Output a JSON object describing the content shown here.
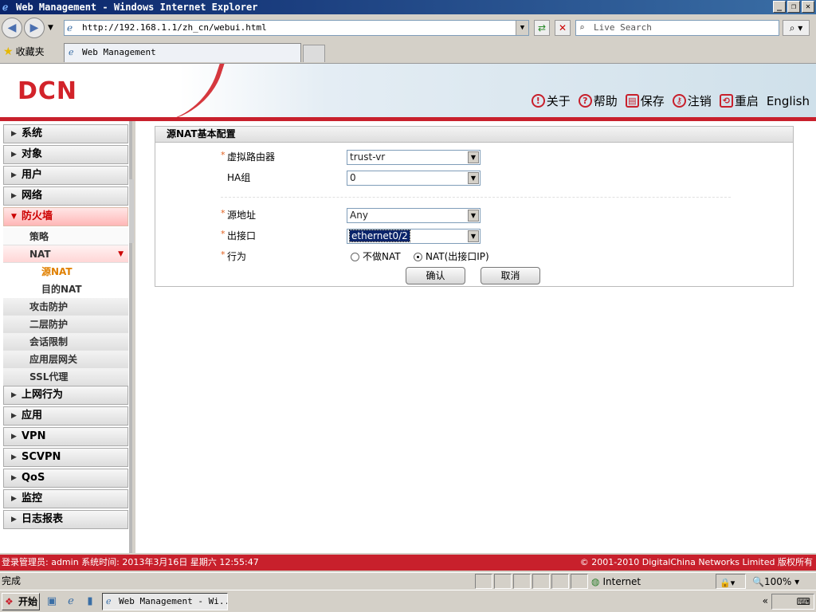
{
  "window": {
    "title": "Web Management - Windows Internet Explorer",
    "minimize": "_",
    "restore": "❐",
    "close": "✕"
  },
  "browser": {
    "address": "http://192.168.1.1/zh_cn/webui.html",
    "search_placeholder": "Live Search",
    "favorites_label": "收藏夹",
    "tab_title": "Web Management"
  },
  "header": {
    "logo": "DCN",
    "links": [
      {
        "icon": "info-icon",
        "glyph": "!",
        "label": "关于"
      },
      {
        "icon": "help-icon",
        "glyph": "?",
        "label": "帮助"
      },
      {
        "icon": "save-icon",
        "glyph": "▤",
        "label": "保存"
      },
      {
        "icon": "key-icon",
        "glyph": "⚷",
        "label": "注销"
      },
      {
        "icon": "restart-icon",
        "glyph": "⟲",
        "label": "重启"
      },
      {
        "icon": "",
        "glyph": "",
        "label": "English"
      }
    ]
  },
  "sidebar": {
    "items": [
      {
        "label": "系统"
      },
      {
        "label": "对象"
      },
      {
        "label": "用户"
      },
      {
        "label": "网络"
      },
      {
        "label": "防火墙"
      }
    ],
    "firewall_sub": [
      {
        "label": "策略"
      },
      {
        "label": "NAT"
      }
    ],
    "nat_sub": [
      {
        "label": "源NAT"
      },
      {
        "label": "目的NAT"
      }
    ],
    "firewall_sub2": [
      {
        "label": "攻击防护"
      },
      {
        "label": "二层防护"
      },
      {
        "label": "会话限制"
      },
      {
        "label": "应用层网关"
      },
      {
        "label": "SSL代理"
      }
    ],
    "items_after": [
      {
        "label": "上网行为"
      },
      {
        "label": "应用"
      },
      {
        "label": "VPN"
      },
      {
        "label": "SCVPN"
      },
      {
        "label": "QoS"
      },
      {
        "label": "监控"
      },
      {
        "label": "日志报表"
      }
    ]
  },
  "form": {
    "title": "源NAT基本配置",
    "required_mark": "*",
    "vrouter_label": "虚拟路由器",
    "vrouter_value": "trust-vr",
    "ha_label": "HA组",
    "ha_value": "0",
    "src_label": "源地址",
    "src_value": "Any",
    "egress_label": "出接口",
    "egress_value": "ethernet0/2",
    "action_label": "行为",
    "action_opt1": "不做NAT",
    "action_opt2": "NAT(出接口IP)",
    "action_selected": "NAT(出接口IP)",
    "confirm": "确认",
    "cancel": "取消"
  },
  "footer": {
    "left": "登录管理员: admin 系统时间: 2013年3月16日 星期六 12:55:47",
    "right": "© 2001-2010 DigitalChina Networks Limited 版权所有"
  },
  "statusbar": {
    "status": "完成",
    "zone": "Internet",
    "zoom": "100%"
  },
  "taskbar": {
    "start": "开始",
    "task": "Web Management - Wi..."
  }
}
